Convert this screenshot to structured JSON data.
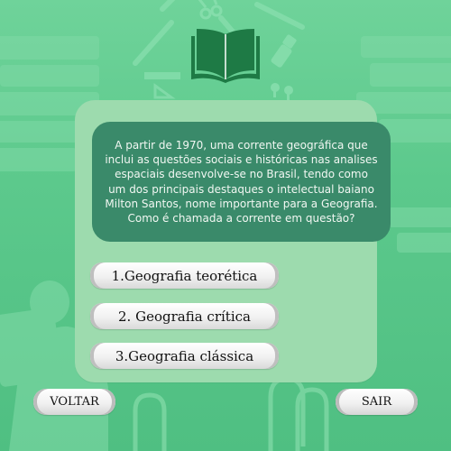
{
  "question": {
    "text": "A partir de 1970, uma corrente geográfica que inclui as questões sociais e históricas nas analises espaciais desenvolve-se no Brasil, tendo como um dos principais destaques o intelectual baiano Milton Santos, nome importante para a Geografia. Como é chamada a corrente em questão?"
  },
  "options": [
    {
      "label": "1.Geografia teorética"
    },
    {
      "label": "2. Geografia crítica"
    },
    {
      "label": "3.Geografia clássica"
    }
  ],
  "nav": {
    "back_label": "VOLTAR",
    "exit_label": "SAIR"
  },
  "icons": {
    "logo": "open-book-icon"
  },
  "colors": {
    "background": "#5cc98c",
    "panel": "#9ddbae",
    "question_box": "#3a8a6a",
    "logo": "#1e7a45"
  }
}
